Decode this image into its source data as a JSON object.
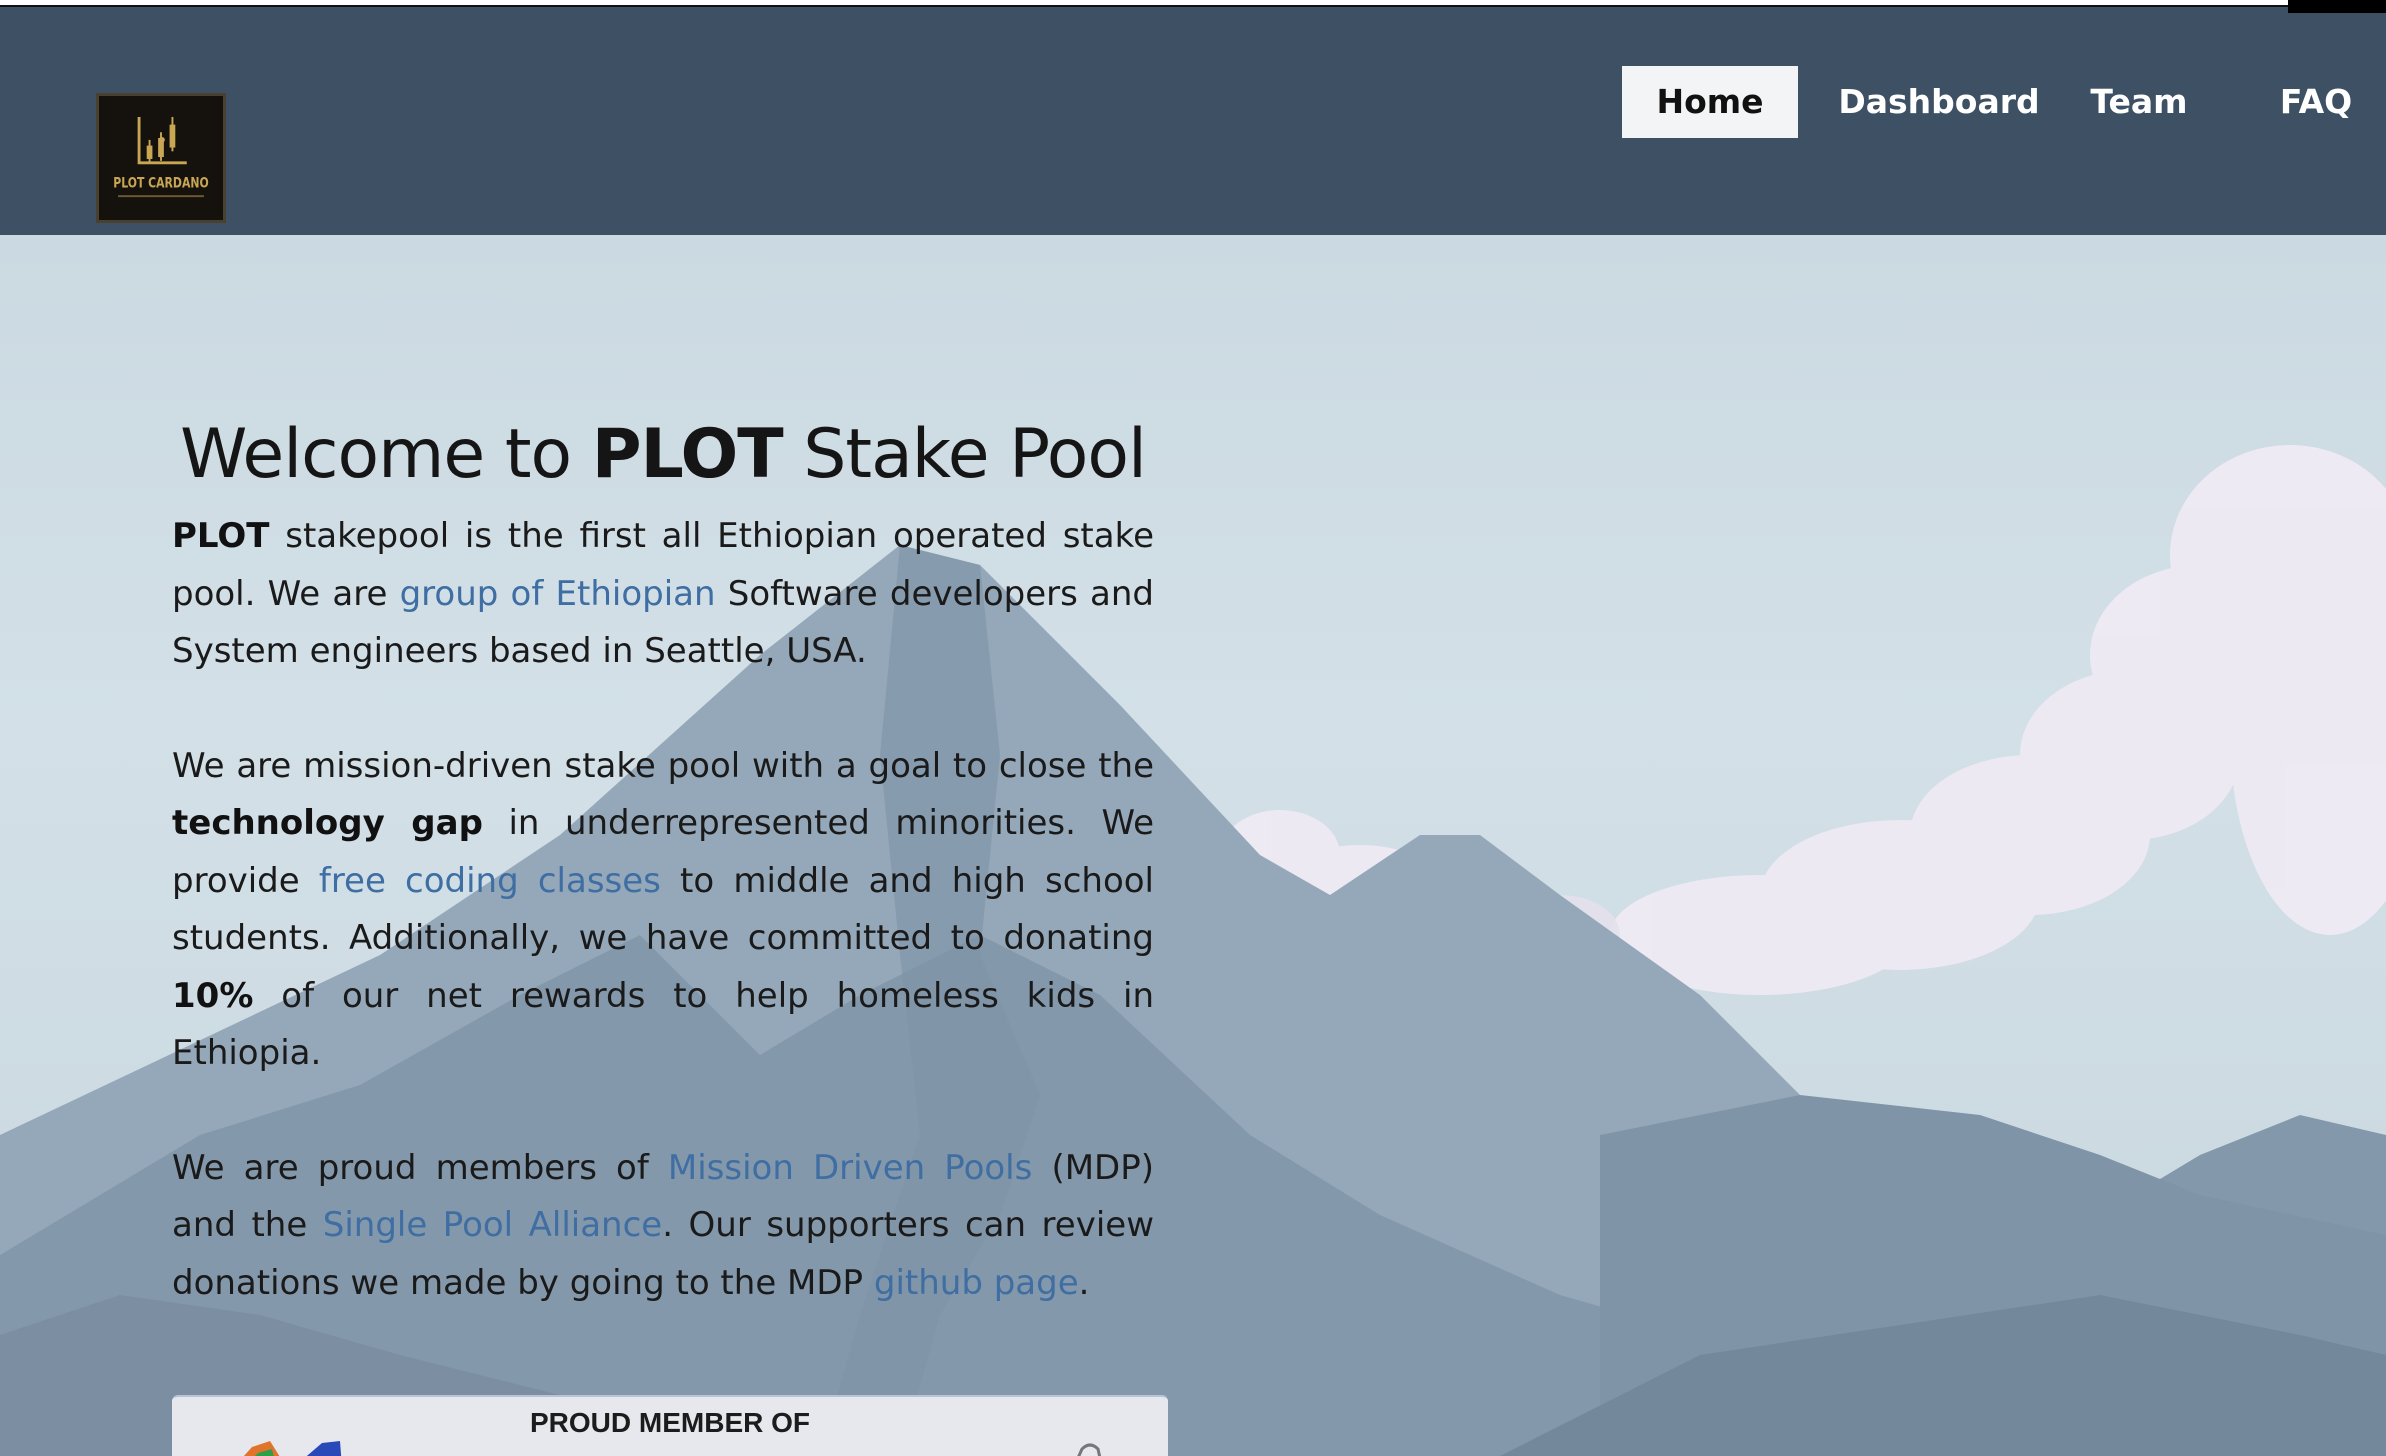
{
  "header": {
    "logo_alt": "PLOT CARDANO",
    "nav": [
      {
        "label": "Home",
        "active": true
      },
      {
        "label": "Dashboard",
        "active": false
      },
      {
        "label": "Team",
        "active": false
      },
      {
        "label": "FAQ",
        "active": false
      }
    ]
  },
  "hero": {
    "title_prefix": "Welcome to ",
    "title_brand": "PLOT",
    "title_suffix": " Stake Pool",
    "p1": {
      "brand": "PLOT",
      "t1": " stakepool is the first all Ethiopian operated stake pool. We are ",
      "link1": "group of Ethiopian",
      "t2": " Software developers and System engineers based in Seattle, USA."
    },
    "p2": {
      "t1": "We are mission-driven stake pool with a goal to close the ",
      "bold1": "technology gap",
      "t2": " in underrepresented minorities. We provide ",
      "link1": "free coding classes",
      "t3": " to middle and high school students. Additionally, we have committed to donating ",
      "bold2": "10%",
      "t4": " of our net rewards to help homeless kids in Ethiopia."
    },
    "p3": {
      "t1": "We are proud members of ",
      "link1": "Mission Driven Pools",
      "t2": " (MDP) and the ",
      "link2": "Single Pool Alliance",
      "t3": ". Our supporters can review donations we made by going to the MDP ",
      "link3": "github page",
      "t4": "."
    },
    "badge_title": "PROUD MEMBER OF"
  },
  "colors": {
    "header_bg": "#3e5063",
    "link": "#3f6ea3",
    "sky": "#ccdae3"
  }
}
